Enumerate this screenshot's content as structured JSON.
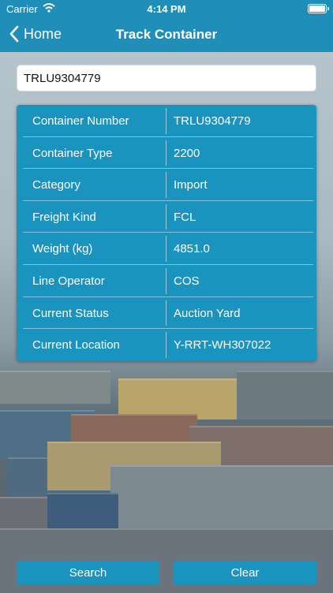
{
  "status_bar": {
    "carrier": "Carrier",
    "time": "4:14 PM"
  },
  "nav": {
    "back_label": "Home",
    "title": "Track Container"
  },
  "search": {
    "value": "TRLU9304779"
  },
  "details": [
    {
      "label": "Container Number",
      "value": "TRLU9304779"
    },
    {
      "label": "Container Type",
      "value": "2200"
    },
    {
      "label": "Category",
      "value": "Import"
    },
    {
      "label": "Freight Kind",
      "value": "FCL"
    },
    {
      "label": "Weight (kg)",
      "value": "4851.0"
    },
    {
      "label": "Line Operator",
      "value": "COS"
    },
    {
      "label": "Current Status",
      "value": "Auction Yard"
    },
    {
      "label": "Current Location",
      "value": "Y-RRT-WH307022"
    }
  ],
  "buttons": {
    "search": "Search",
    "clear": "Clear"
  },
  "colors": {
    "accent": "#1f8eb8",
    "card": "#1b93bf"
  },
  "icons": {
    "back": "chevron-left-icon",
    "wifi": "wifi-icon",
    "battery": "battery-icon"
  }
}
